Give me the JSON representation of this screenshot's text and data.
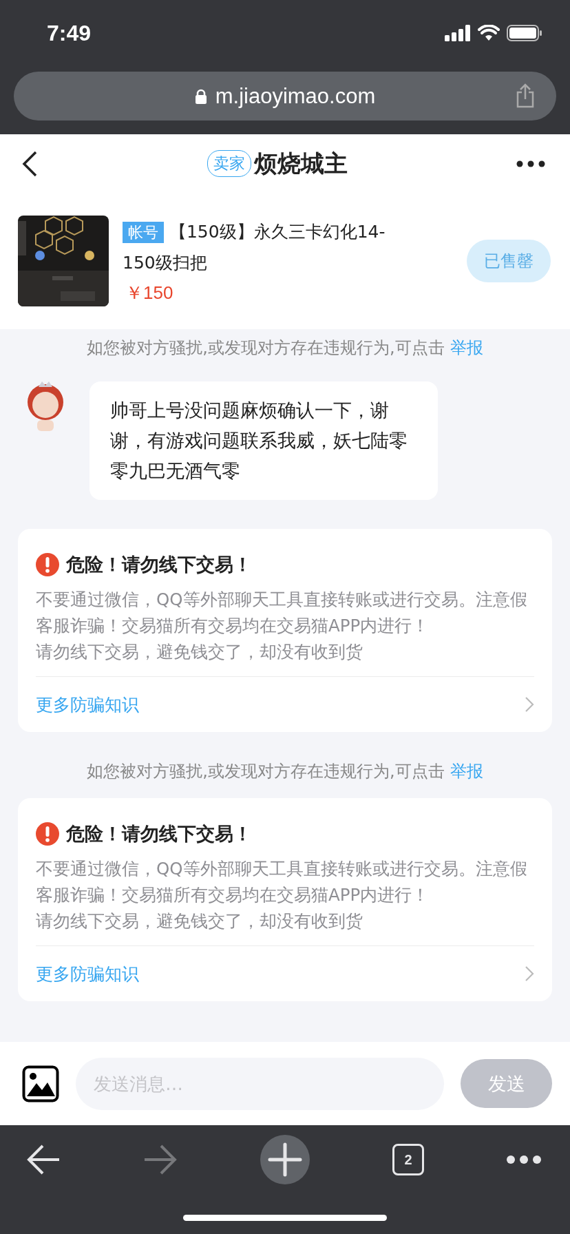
{
  "status_bar": {
    "time": "7:49"
  },
  "browser": {
    "url": "m.jiaoyimao.com",
    "tab_count": "2",
    "forward_disabled": true
  },
  "header": {
    "badge": "卖家",
    "title": "烦烧城主"
  },
  "product": {
    "tag": "帐号",
    "title": "【150级】永久三卡幻化14-150级扫把",
    "price": "￥150",
    "status_button": "已售罄",
    "status_disabled": true
  },
  "chat": [
    {
      "kind": "notice",
      "text": "如您被对方骚扰,或发现对方存在违规行为,可点击",
      "link": "举报"
    },
    {
      "kind": "message",
      "text": "帅哥上号没问题麻烦确认一下，谢谢，有游戏问题联系我威，妖七陆零零九巴无酒气零"
    },
    {
      "kind": "warning",
      "title": "危险！请勿线下交易！",
      "lines": [
        "不要通过微信，QQ等外部聊天工具直接转账或进行交易。注意假客服诈骗！交易猫所有交易均在交易猫APP内进行！",
        "请勿线下交易，避免钱交了，却没有收到货"
      ],
      "link": "更多防骗知识"
    },
    {
      "kind": "notice",
      "text": "如您被对方骚扰,或发现对方存在违规行为,可点击",
      "link": "举报"
    },
    {
      "kind": "warning",
      "title": "危险！请勿线下交易！",
      "lines": [
        "不要通过微信，QQ等外部聊天工具直接转账或进行交易。注意假客服诈骗！交易猫所有交易均在交易猫APP内进行！",
        "请勿线下交易，避免钱交了，却没有收到货"
      ],
      "link": "更多防骗知识"
    }
  ],
  "composer": {
    "placeholder": "发送消息…",
    "send": "发送",
    "send_disabled": true
  }
}
